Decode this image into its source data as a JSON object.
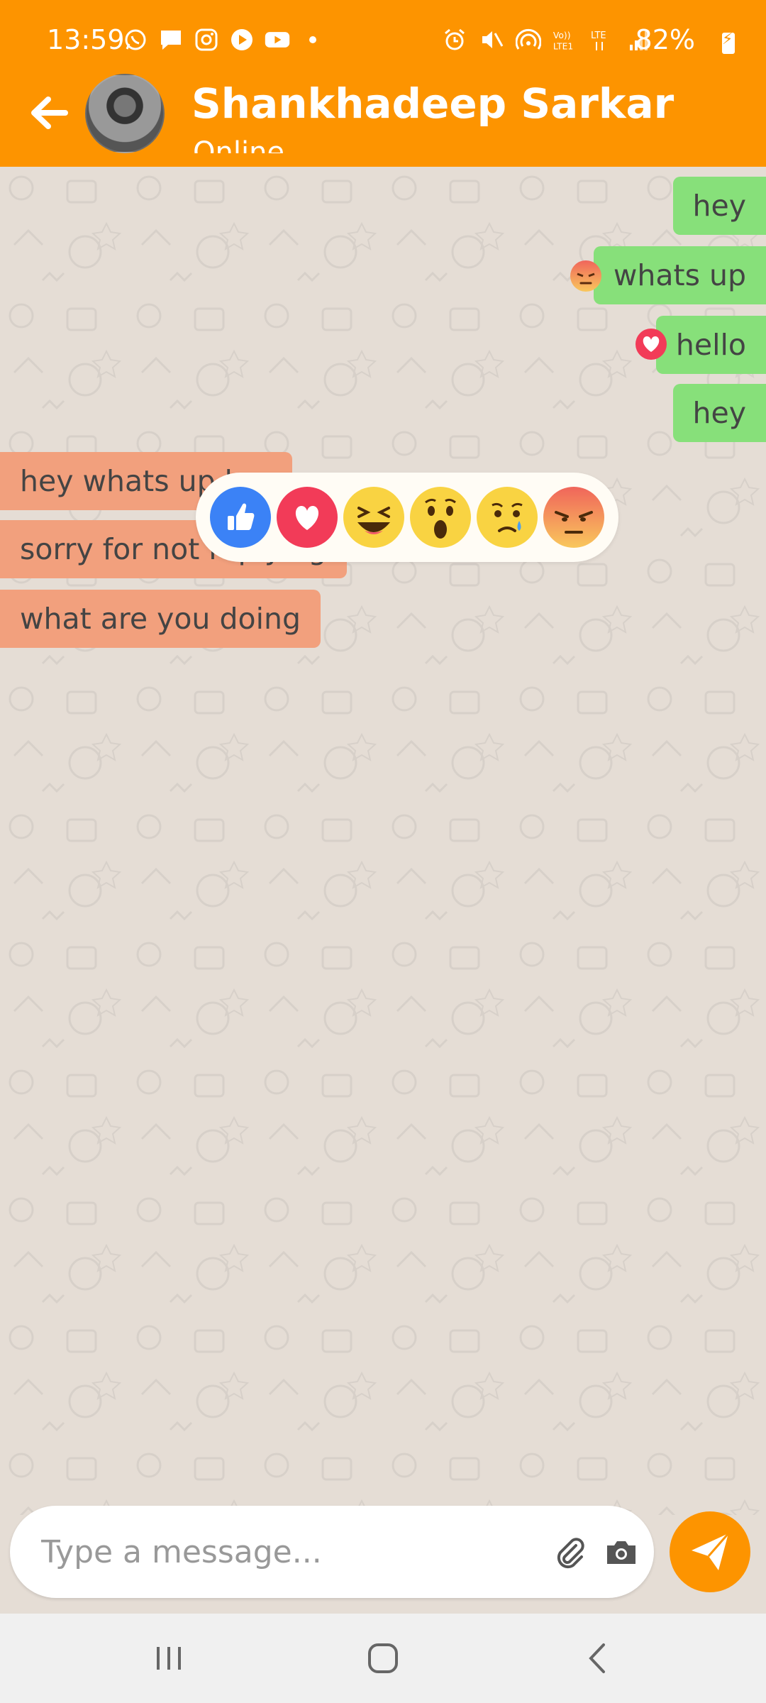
{
  "status_bar": {
    "time": "13:59",
    "battery": "82%"
  },
  "header": {
    "contact_name": "Shankhadeep Sarkar",
    "contact_status": "Online"
  },
  "messages": [
    {
      "direction": "outgoing",
      "text": "hey",
      "reaction": null
    },
    {
      "direction": "outgoing",
      "text": "whats up",
      "reaction": "angry"
    },
    {
      "direction": "outgoing",
      "text": "hello",
      "reaction": "love"
    },
    {
      "direction": "outgoing",
      "text": "hey",
      "reaction": null
    },
    {
      "direction": "incoming",
      "text": "hey whats up bro",
      "reaction": null
    },
    {
      "direction": "incoming",
      "text": "sorry for not replying",
      "reaction": null
    },
    {
      "direction": "incoming",
      "text": "what are you doing",
      "reaction": null
    }
  ],
  "reaction_picker": {
    "options": [
      "like",
      "love",
      "haha",
      "wow",
      "sad",
      "angry"
    ]
  },
  "composer": {
    "placeholder": "Type a message..."
  },
  "colors": {
    "accent": "#fd9400",
    "outgoing_bubble": "#87e07a",
    "incoming_bubble": "#f2a07d",
    "chat_background": "#e5ddd5"
  },
  "icons": {
    "back": "arrow-left-icon",
    "attach": "paperclip-icon",
    "camera": "camera-icon",
    "send": "send-icon",
    "nav_recent": "recent-apps-icon",
    "nav_home": "home-icon",
    "nav_back": "nav-back-icon"
  }
}
